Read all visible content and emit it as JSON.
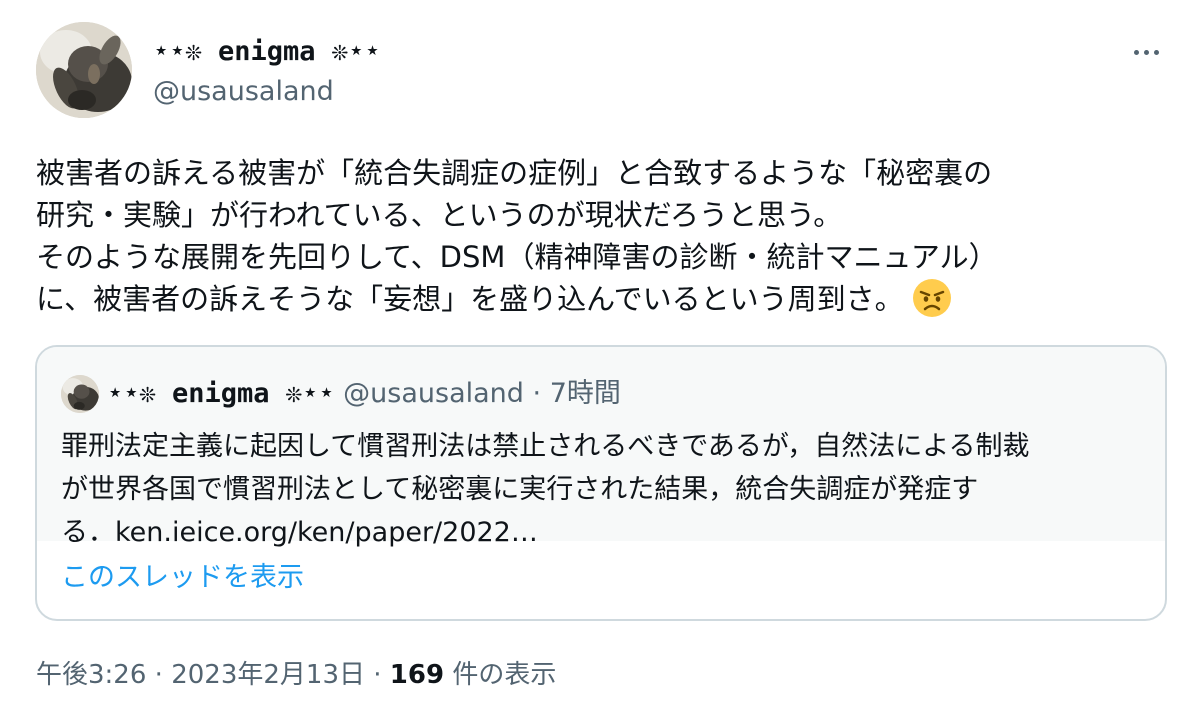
{
  "tweet": {
    "author": {
      "name": "⋆⋆❊ enigma ❊⋆⋆",
      "handle": "@usausaland"
    },
    "text_lines": [
      "被害者の訴える被害が「統合失調症の症例」と合致するような「秘密裏の",
      "研究・実験」が行われている、というのが現状だろうと思う。",
      "そのような展開を先回りして、DSM（精神障害の診断・統計マニュアル）",
      "に、被害者の訴えそうな「妄想」を盛り込んでいるという周到さ。"
    ],
    "emoji": "angry-face-icon",
    "quoted": {
      "name": "⋆⋆❊ enigma ❊⋆⋆",
      "handle": "@usausaland",
      "separator": "·",
      "time": "7時間",
      "text_lines": [
        "罪刑法定主義に起因して慣習刑法は禁止されるべきであるが，自然法による制裁",
        "が世界各国で慣習刑法として秘密裏に実行された結果，統合失調症が発症す",
        "る．ken.ieice.org/ken/paper/2022…"
      ],
      "show_thread_label": "このスレッドを表示"
    },
    "meta": {
      "time": "午後3:26",
      "dot1": "·",
      "date": "2023年2月13日",
      "dot2": "·",
      "views_count": "169",
      "views_label": "件の表示"
    }
  },
  "colors": {
    "text": "#0f1419",
    "secondary": "#536471",
    "link": "#1d9bf0",
    "border": "#cfd9de",
    "quote_bg": "#f7f9f9"
  }
}
